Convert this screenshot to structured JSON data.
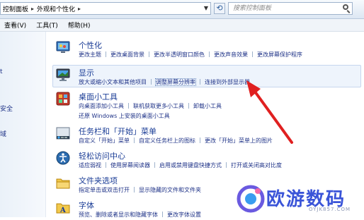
{
  "address": {
    "crumbs": [
      "控制面板",
      "外观和个性化"
    ],
    "search_placeholder": "搜索控制面板"
  },
  "menu": [
    "查看(V)",
    "工具(T)",
    "帮助(H)"
  ],
  "left_pane": [
    "t",
    "安全",
    "域"
  ],
  "categories": [
    {
      "title": "个性化",
      "rows": [
        [
          "更改主题",
          "更改桌面背景",
          "更改半透明窗口颜色",
          "更改声音效果",
          "更改屏幕保护程序"
        ]
      ]
    },
    {
      "title": "显示",
      "rows": [
        [
          "放大或缩小文本和其他项目",
          "调整屏幕分辨率",
          "连接到外部显示器"
        ]
      ]
    },
    {
      "title": "桌面小工具",
      "rows": [
        [
          "向桌面添加小工具",
          "联机获取更多小工具",
          "卸载小工具"
        ],
        [
          "还原 Windows 上安装的桌面小工具"
        ]
      ]
    },
    {
      "title": "任务栏和「开始」菜单",
      "rows": [
        [
          "自定义「开始」菜单",
          "自定义任务栏上的图标",
          "更改「开始」菜单上的图片"
        ]
      ]
    },
    {
      "title": "轻松访问中心",
      "rows": [
        [
          "适应弱视",
          "使用屏幕阅读器",
          "启用或禁用键盘快捷方式",
          "打开或关闭高对比度"
        ]
      ]
    },
    {
      "title": "文件夹选项",
      "rows": [
        [
          "指定单击或双击打开",
          "显示隐藏的文件和文件夹"
        ]
      ]
    },
    {
      "title": "字体",
      "rows": [
        [
          "预览、删除或者显示和隐藏字体",
          "更改字体设置"
        ]
      ]
    }
  ],
  "watermark": {
    "text": "欧游数码",
    "url": "OYJK857.COM"
  }
}
